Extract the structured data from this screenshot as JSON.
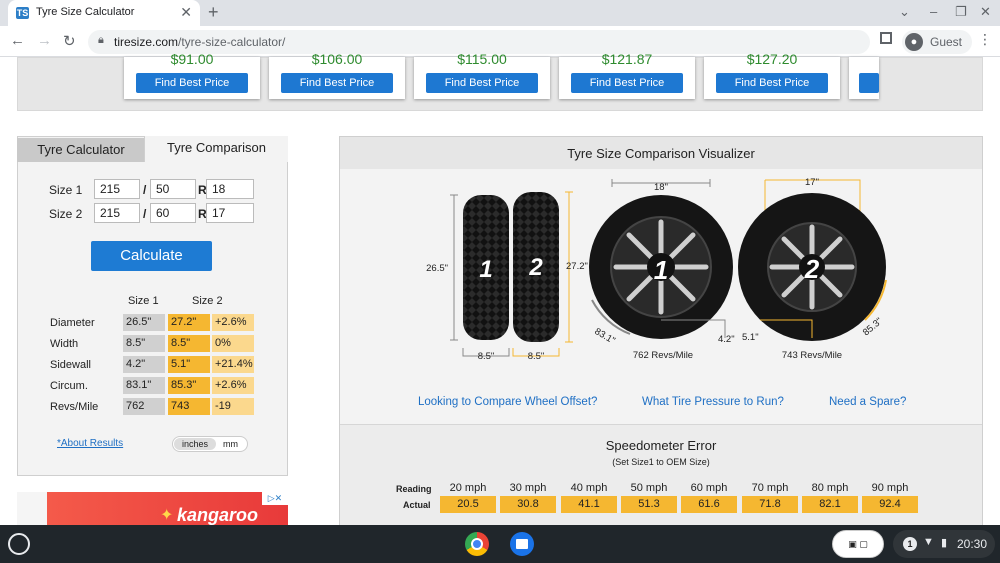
{
  "browser": {
    "tab_title": "Tyre Size Calculator",
    "tab_favicon": "TS",
    "url_host": "tiresize.com",
    "url_path": "/tyre-size-calculator/",
    "profile_label": "Guest"
  },
  "price_cards": [
    {
      "price": "$91.00",
      "button": "Find Best Price"
    },
    {
      "price": "$106.00",
      "button": "Find Best Price"
    },
    {
      "price": "$115.00",
      "button": "Find Best Price"
    },
    {
      "price": "$121.87",
      "button": "Find Best Price"
    },
    {
      "price": "$127.20",
      "button": "Find Best Price"
    }
  ],
  "calculator": {
    "tabs": [
      "Tyre Calculator",
      "Tyre Comparison"
    ],
    "size1": {
      "label": "Size 1",
      "width": "215",
      "ratio": "50",
      "r": "R",
      "rim": "18"
    },
    "size2": {
      "label": "Size 2",
      "width": "215",
      "ratio": "60",
      "r": "R",
      "rim": "17"
    },
    "slash": "/",
    "calculate_label": "Calculate",
    "table_headers": [
      "Size 1",
      "Size 2"
    ],
    "rows": [
      {
        "label": "Diameter",
        "s1": "26.5\"",
        "s2": "27.2\"",
        "diff": "+2.6%"
      },
      {
        "label": "Width",
        "s1": "8.5\"",
        "s2": "8.5\"",
        "diff": "0%"
      },
      {
        "label": "Sidewall",
        "s1": "4.2\"",
        "s2": "5.1\"",
        "diff": "+21.4%"
      },
      {
        "label": "Circum.",
        "s1": "83.1\"",
        "s2": "85.3\"",
        "diff": "+2.6%"
      },
      {
        "label": "Revs/Mile",
        "s1": "762",
        "s2": "743",
        "diff": "-19"
      }
    ],
    "about_link": "*About Results",
    "unit_inches": "inches",
    "unit_mm": "mm"
  },
  "ad": {
    "brand": "kangaroo"
  },
  "visualizer": {
    "title": "Tyre Size Comparison Visualizer",
    "tire1_num": "1",
    "tire2_num": "2",
    "dia1": "26.5\"",
    "dia2": "27.2\"",
    "width1": "8.5\"",
    "width2": "8.5\"",
    "rim1": "18\"",
    "rim2": "17\"",
    "circ1": "83.1\"",
    "circ2": "85.3\"",
    "side1": "4.2\"",
    "side2": "5.1\"",
    "revs1": "762 Revs/Mile",
    "revs2": "743 Revs/Mile"
  },
  "links": [
    "Looking to Compare Wheel Offset?",
    "What Tire Pressure to Run?",
    "Need a Spare?"
  ],
  "speedo": {
    "title": "Speedometer Error",
    "subtitle": "(Set Size1 to OEM Size)",
    "reading_label": "Reading",
    "actual_label": "Actual",
    "readings": [
      "20 mph",
      "30 mph",
      "40 mph",
      "50 mph",
      "60 mph",
      "70 mph",
      "80 mph",
      "90 mph"
    ],
    "actuals": [
      "20.5",
      "30.8",
      "41.1",
      "51.3",
      "61.6",
      "71.8",
      "82.1",
      "92.4"
    ]
  },
  "taskbar": {
    "notif_count": "1",
    "time": "20:30"
  },
  "colors": {
    "accent_blue": "#1e7bd3",
    "size2_orange": "#f5b731",
    "price_green": "#2e8b2e"
  }
}
